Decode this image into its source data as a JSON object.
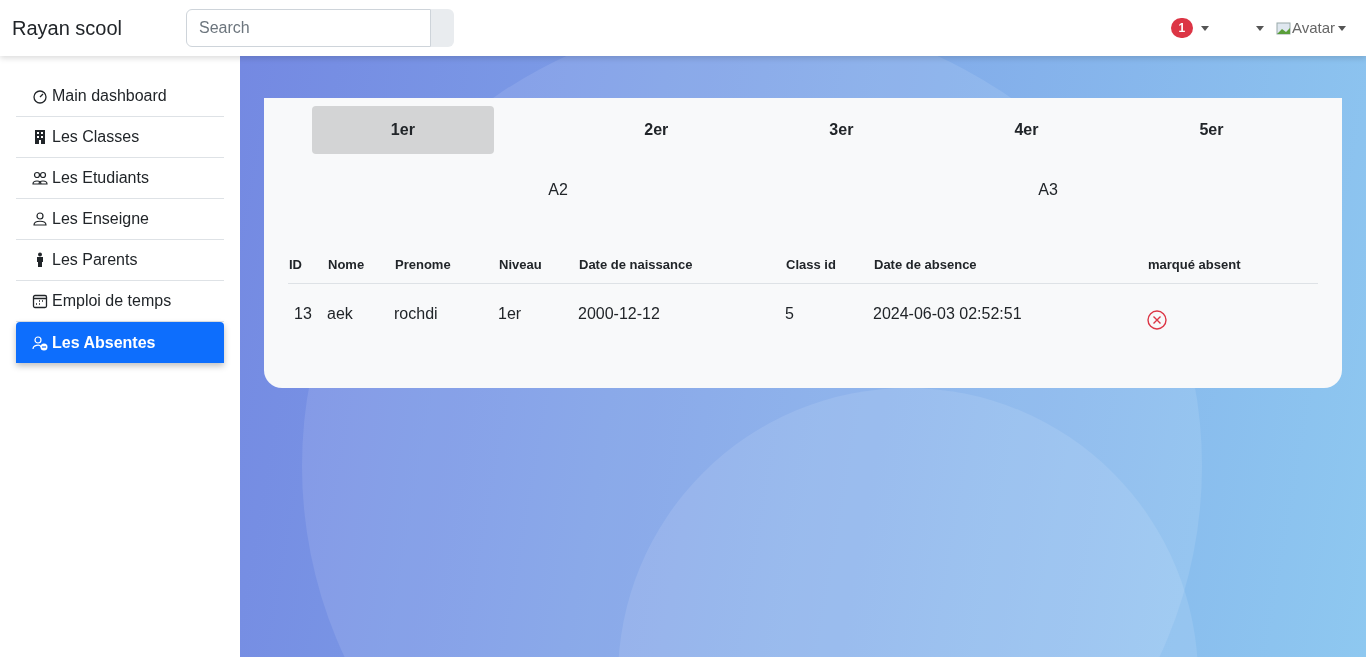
{
  "navbar": {
    "brand": "Rayan scool",
    "search": {
      "placeholder": "Search"
    },
    "notification_count": "1",
    "avatar_alt": "Avatar"
  },
  "sidebar": {
    "items": [
      {
        "label": "Main dashboard",
        "selected": false
      },
      {
        "label": "Les Classes",
        "selected": false
      },
      {
        "label": "Les Etudiants",
        "selected": false
      },
      {
        "label": "Les Enseigne",
        "selected": false
      },
      {
        "label": "Les Parents",
        "selected": false
      },
      {
        "label": "Emploi de temps",
        "selected": false
      },
      {
        "label": "Les Absentes",
        "selected": true
      }
    ]
  },
  "level_tabs": [
    {
      "label": "1er",
      "selected": true
    },
    {
      "label": "2er",
      "selected": false
    },
    {
      "label": "3er",
      "selected": false
    },
    {
      "label": "4er",
      "selected": false
    },
    {
      "label": "5er",
      "selected": false
    }
  ],
  "class_tabs": [
    "A2",
    "A3"
  ],
  "table": {
    "columns": [
      "ID",
      "Nome",
      "Prenome",
      "Niveau",
      "Date de naissance",
      "Class id",
      "Date de absence",
      "marqué absent"
    ],
    "rows": [
      {
        "cells": [
          "13",
          "aek",
          "rochdi",
          "1er",
          "2000-12-12",
          "5",
          "2024-06-03 02:52:51"
        ],
        "absent": true
      }
    ]
  }
}
